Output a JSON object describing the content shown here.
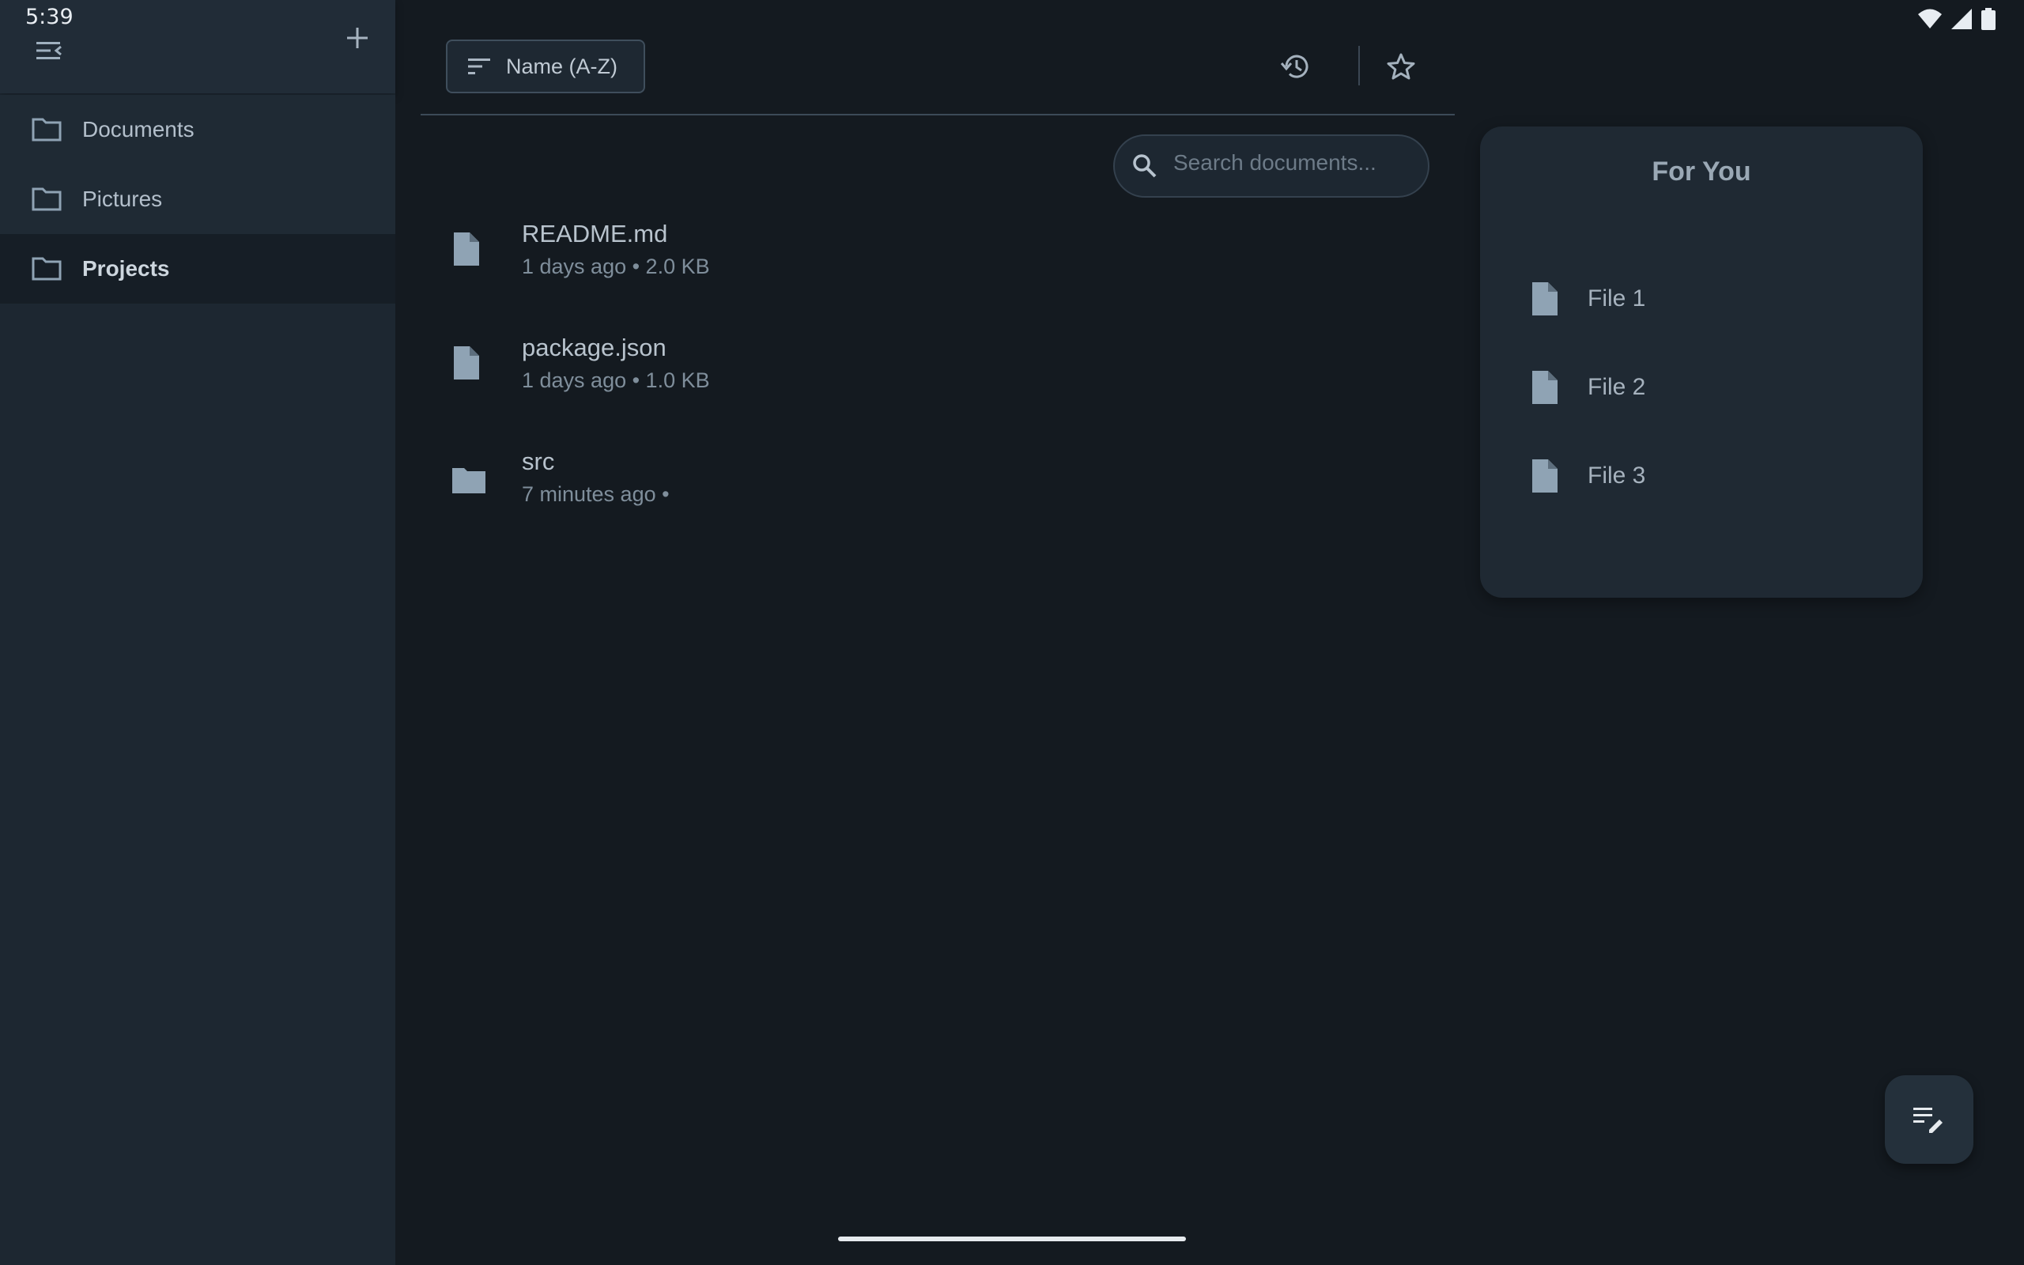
{
  "status_bar": {
    "time": "5:39"
  },
  "sidebar": {
    "items": [
      {
        "label": "Documents",
        "selected": false
      },
      {
        "label": "Pictures",
        "selected": false
      },
      {
        "label": "Projects",
        "selected": true
      }
    ]
  },
  "toolbar": {
    "sort_label": "Name (A-Z)"
  },
  "search": {
    "placeholder": "Search documents..."
  },
  "files": [
    {
      "name": "README.md",
      "meta": "1 days ago • 2.0 KB",
      "icon": "file-icon"
    },
    {
      "name": "package.json",
      "meta": "1 days ago • 1.0 KB",
      "icon": "file-icon"
    },
    {
      "name": "src",
      "meta": "7 minutes ago •",
      "icon": "folder-icon"
    }
  ],
  "for_you": {
    "title": "For You",
    "items": [
      {
        "label": "File 1"
      },
      {
        "label": "File 2"
      },
      {
        "label": "File 3"
      }
    ]
  },
  "colors": {
    "background": "#141a20",
    "sidebar": "#1d2731",
    "card": "#1f2933",
    "icon": "#8fa3b4"
  }
}
